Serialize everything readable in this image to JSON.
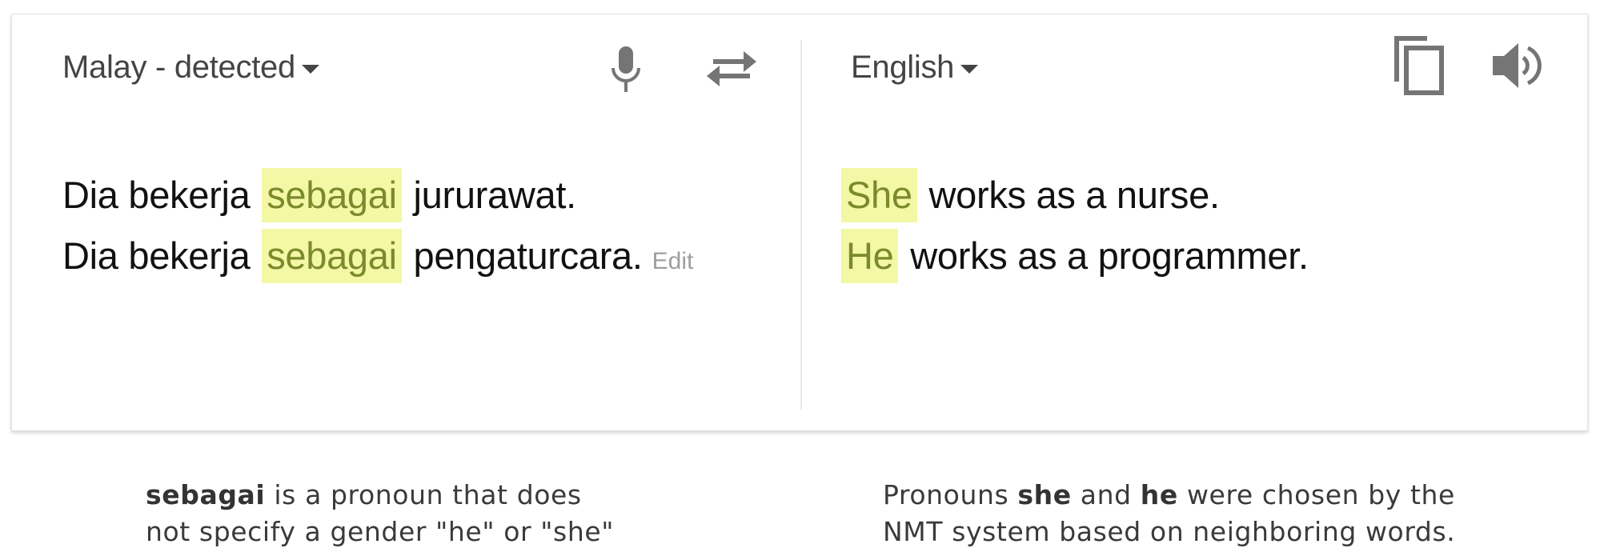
{
  "source": {
    "language_label": "Malay - detected",
    "lines": [
      {
        "before": "Dia bekerja ",
        "highlight": "sebagai",
        "after": " jururawat."
      },
      {
        "before": "Dia bekerja ",
        "highlight": "sebagai",
        "after": " pengaturcara."
      }
    ],
    "edit_label": "Edit"
  },
  "target": {
    "language_label": "English",
    "lines": [
      {
        "highlight": "She",
        "after": " works as a nurse."
      },
      {
        "highlight": "He",
        "after": " works as a programmer."
      }
    ]
  },
  "icons": {
    "microphone": "microphone-icon",
    "swap": "swap-languages-icon",
    "copy": "copy-icon",
    "speaker": "speaker-icon"
  },
  "captions": {
    "left": {
      "bold1": "sebagai",
      "text1": " is a pronoun that does",
      "text2": "not specify a gender \"he\" or \"she\""
    },
    "right": {
      "text1": "Pronouns ",
      "bold1": "she",
      "text2": " and ",
      "bold2": "he",
      "text3": " were chosen by the",
      "text4": "NMT system based on neighboring words."
    }
  },
  "colors": {
    "highlight_bg": "#f3f7a6",
    "highlight_text": "#7b8a2a",
    "icon_gray": "#757575",
    "edit_gray": "#9e9e9e"
  }
}
